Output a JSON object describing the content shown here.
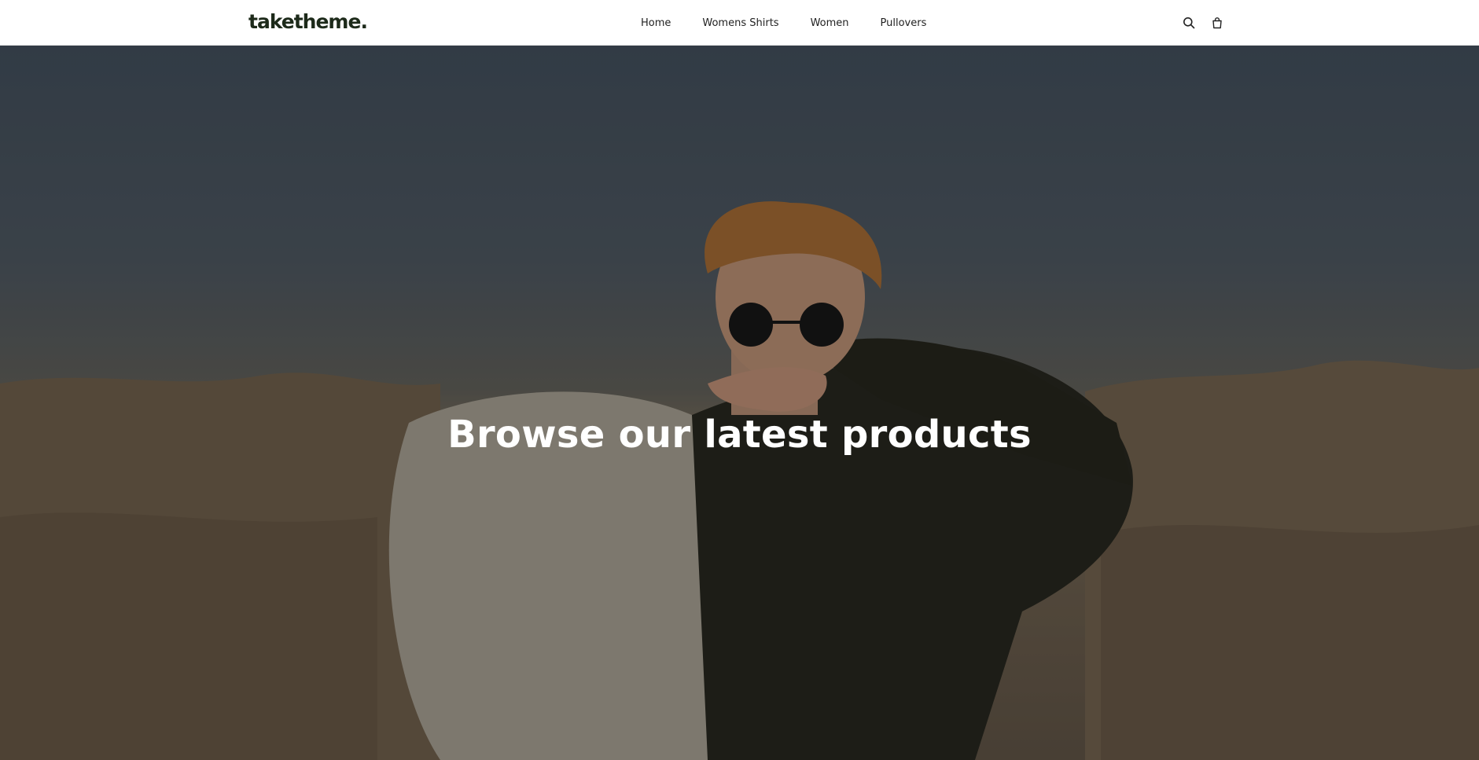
{
  "header": {
    "logo_text": "taketheme.",
    "nav": [
      {
        "label": "Home"
      },
      {
        "label": "Womens Shirts"
      },
      {
        "label": "Women"
      },
      {
        "label": "Pullovers"
      }
    ],
    "icons": {
      "search": "search-icon",
      "cart": "shopping-bag-icon"
    }
  },
  "hero": {
    "title": "Browse our latest products"
  },
  "colors": {
    "header_bg": "#ffffff",
    "logo": "#1d2a1a",
    "hero_text": "#ffffff"
  }
}
